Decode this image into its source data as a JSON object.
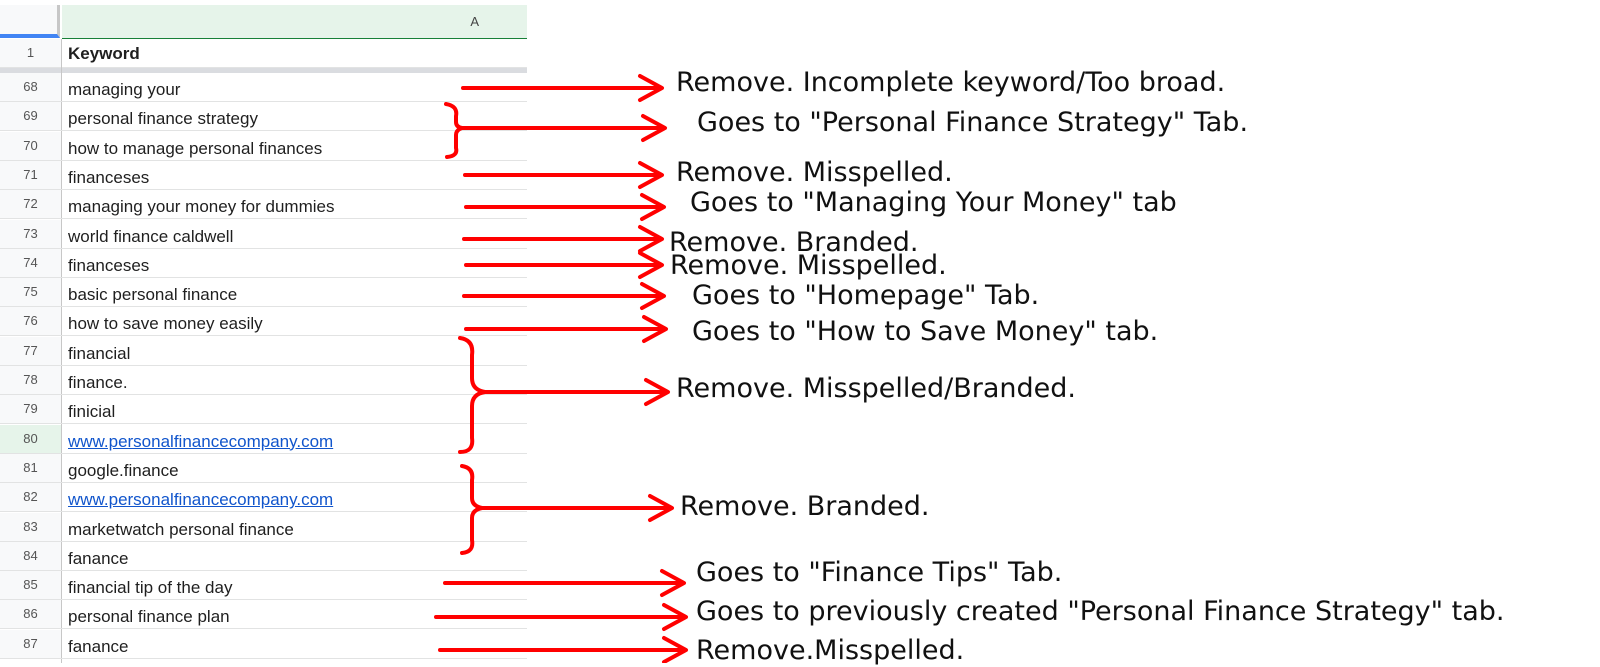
{
  "spreadsheet": {
    "column_header": "A",
    "header_row": {
      "num": "1",
      "value": "Keyword"
    },
    "rows": [
      {
        "num": "68",
        "value": "managing your"
      },
      {
        "num": "69",
        "value": "personal finance strategy"
      },
      {
        "num": "70",
        "value": "how to manage personal finances"
      },
      {
        "num": "71",
        "value": "financeses"
      },
      {
        "num": "72",
        "value": "managing your money for dummies"
      },
      {
        "num": "73",
        "value": "world finance caldwell"
      },
      {
        "num": "74",
        "value": "financeses"
      },
      {
        "num": "75",
        "value": "basic personal finance"
      },
      {
        "num": "76",
        "value": "how to save money easily"
      },
      {
        "num": "77",
        "value": "financial"
      },
      {
        "num": "78",
        "value": "finance."
      },
      {
        "num": "79",
        "value": "finicial"
      },
      {
        "num": "80",
        "value": "www.personalfinancecompany.com"
      },
      {
        "num": "81",
        "value": "google.finance"
      },
      {
        "num": "82",
        "value": "www.personalfinancecompany.com"
      },
      {
        "num": "83",
        "value": "marketwatch personal finance"
      },
      {
        "num": "84",
        "value": "fanance"
      },
      {
        "num": "85",
        "value": "financial tip of the day"
      },
      {
        "num": "86",
        "value": "personal finance plan"
      },
      {
        "num": "87",
        "value": "fanance"
      }
    ]
  },
  "annotations": [
    "Remove. Incomplete keyword/Too broad.",
    "Goes to \"Personal Finance Strategy\" Tab.",
    "Remove. Misspelled.",
    "Goes to \"Managing Your Money\" tab",
    "Remove. Branded.",
    "Remove. Misspelled.",
    "Goes to \"Homepage\" Tab.",
    "Goes to \"How to Save Money\" tab.",
    "Remove. Misspelled/Branded.",
    "Remove. Branded.",
    "Goes to \"Finance Tips\" Tab.",
    "Goes to previously created \"Personal Finance Strategy\" tab.",
    "Remove.Misspelled."
  ],
  "colors": {
    "arrow": "#ff0000",
    "link": "#1155cc",
    "selected_row": "#e6f4ea",
    "column_selected": "#e6f4ea"
  }
}
